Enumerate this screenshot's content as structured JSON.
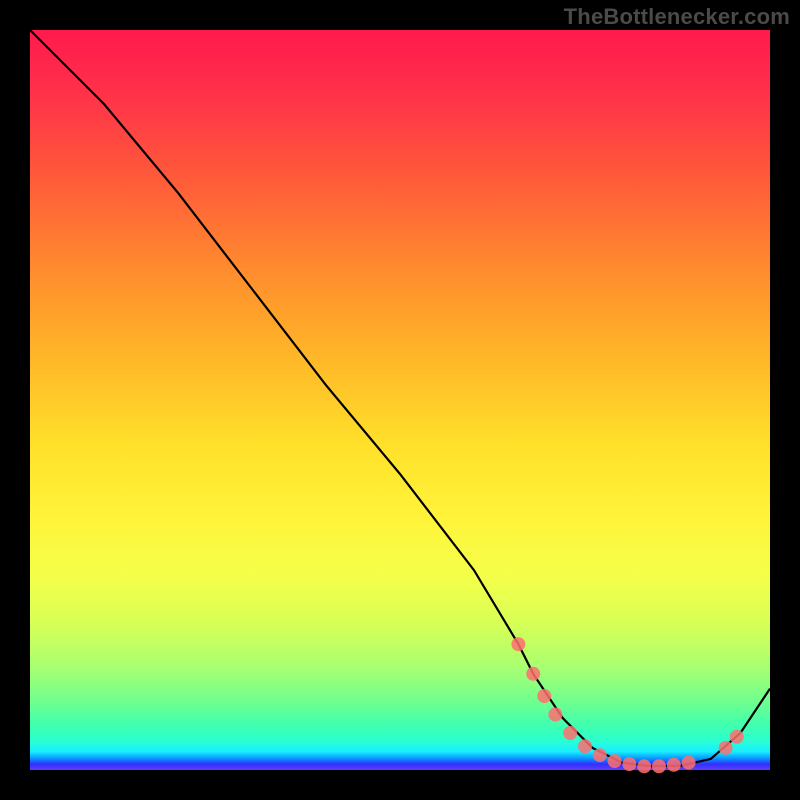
{
  "attribution": "TheBottlenecker.com",
  "chart_data": {
    "type": "line",
    "title": "",
    "xlabel": "",
    "ylabel": "",
    "xlim": [
      0,
      100
    ],
    "ylim": [
      0,
      100
    ],
    "series": [
      {
        "name": "curve",
        "x": [
          0,
          6,
          10,
          20,
          30,
          40,
          50,
          60,
          66,
          68,
          72,
          76,
          80,
          84,
          88,
          92,
          96,
          100
        ],
        "y": [
          100,
          94,
          90,
          78,
          65,
          52,
          40,
          27,
          17,
          13,
          7,
          3,
          1,
          0.5,
          0.6,
          1.5,
          5,
          11
        ]
      }
    ],
    "markers": [
      {
        "x": 66.0,
        "y": 17.0
      },
      {
        "x": 68.0,
        "y": 13.0
      },
      {
        "x": 69.5,
        "y": 10.0
      },
      {
        "x": 71.0,
        "y": 7.5
      },
      {
        "x": 73.0,
        "y": 5.0
      },
      {
        "x": 75.0,
        "y": 3.2
      },
      {
        "x": 77.0,
        "y": 2.0
      },
      {
        "x": 79.0,
        "y": 1.2
      },
      {
        "x": 81.0,
        "y": 0.8
      },
      {
        "x": 83.0,
        "y": 0.5
      },
      {
        "x": 85.0,
        "y": 0.5
      },
      {
        "x": 87.0,
        "y": 0.7
      },
      {
        "x": 89.0,
        "y": 1.0
      },
      {
        "x": 94.0,
        "y": 3.0
      },
      {
        "x": 95.5,
        "y": 4.5
      }
    ],
    "marker_color": "#ff6e6e",
    "line_color": "#000000"
  }
}
